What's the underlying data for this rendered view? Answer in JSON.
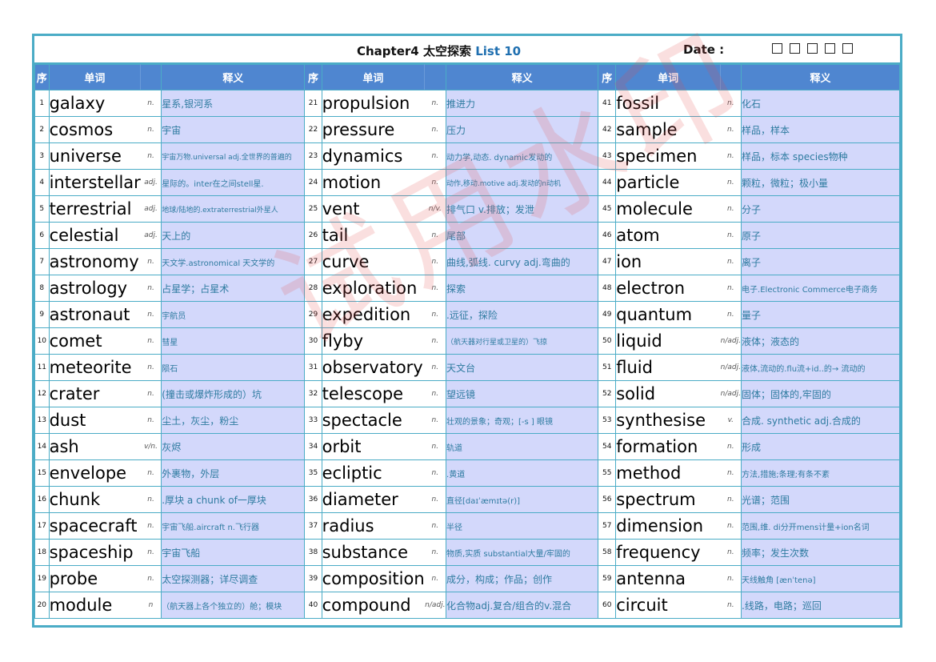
{
  "title": {
    "chapter": "Chapter4 太空探索",
    "list": "List 10"
  },
  "date": {
    "label": "Date :",
    "boxes": 5
  },
  "headers": {
    "seq": "序",
    "word": "单词",
    "meaning": "释义"
  },
  "watermark": "试用水印",
  "columns": [
    [
      {
        "n": "1",
        "word": "galaxy",
        "pos": "n.",
        "meaning": "星系,银河系"
      },
      {
        "n": "2",
        "word": "cosmos",
        "pos": "n.",
        "meaning": "宇宙"
      },
      {
        "n": "3",
        "word": "universe",
        "pos": "n.",
        "meaning": "宇宙万物.universal adj.全世界的普遍的",
        "size": "tiny"
      },
      {
        "n": "4",
        "word": "interstellar",
        "pos": "adj.",
        "meaning": "星际的。inter在之间stell星.",
        "size": "small"
      },
      {
        "n": "5",
        "word": "terrestrial",
        "pos": "adj.",
        "meaning": "地球/陆地的.extraterrestrial外星人",
        "size": "tiny"
      },
      {
        "n": "6",
        "word": "celestial",
        "pos": "adj.",
        "meaning": "天上的"
      },
      {
        "n": "7",
        "word": "astronomy",
        "pos": "n.",
        "meaning": "天文学.astronomical 天文学的",
        "size": "small"
      },
      {
        "n": "8",
        "word": "astrology",
        "pos": "n.",
        "meaning": "占星学；占星术"
      },
      {
        "n": "9",
        "word": "astronaut",
        "pos": "n.",
        "meaning": "宇航员",
        "size": "small"
      },
      {
        "n": "10",
        "word": "comet",
        "pos": "n.",
        "meaning": "彗星",
        "size": "small"
      },
      {
        "n": "11",
        "word": "meteorite",
        "pos": "n.",
        "meaning": "陨石",
        "size": "small"
      },
      {
        "n": "12",
        "word": "crater",
        "pos": "n.",
        "meaning": "(撞击或爆炸形成的）坑"
      },
      {
        "n": "13",
        "word": "dust",
        "pos": "n.",
        "meaning": "尘土，灰尘，粉尘"
      },
      {
        "n": "14",
        "word": "ash",
        "pos": "v/n.",
        "meaning": "灰烬"
      },
      {
        "n": "15",
        "word": "envelope",
        "pos": "n.",
        "meaning": "外裹物，外层"
      },
      {
        "n": "16",
        "word": "chunk",
        "pos": "n.",
        "meaning": ".厚块 a chunk of一厚块"
      },
      {
        "n": "17",
        "word": "spacecraft",
        "pos": "n.",
        "meaning": "宇宙飞船.aircraft n.飞行器",
        "size": "small"
      },
      {
        "n": "18",
        "word": "spaceship",
        "pos": "n.",
        "meaning": "宇宙飞船"
      },
      {
        "n": "19",
        "word": "probe",
        "pos": "n.",
        "meaning": "太空探测器；详尽调查"
      },
      {
        "n": "20",
        "word": "module",
        "pos": "n",
        "meaning": "（航天器上各个独立的）舱；模块",
        "size": "small"
      }
    ],
    [
      {
        "n": "21",
        "word": "propulsion",
        "pos": "n.",
        "meaning": "推进力"
      },
      {
        "n": "22",
        "word": "pressure",
        "pos": "n.",
        "meaning": "压力"
      },
      {
        "n": "23",
        "word": "dynamics",
        "pos": "n.",
        "meaning": "动力学,动态. dynamic发动的",
        "size": "small"
      },
      {
        "n": "24",
        "word": "motion",
        "pos": "n.",
        "meaning": "动作,移动.motive adj.发动的n动机",
        "size": "tiny"
      },
      {
        "n": "25",
        "word": "vent",
        "pos": "n/v.",
        "meaning": "排气口 v.排放；发泄"
      },
      {
        "n": "26",
        "word": "tail",
        "pos": "n.",
        "meaning": "尾部"
      },
      {
        "n": "27",
        "word": "curve",
        "pos": "n.",
        "meaning": "曲线,弧线. curvy adj.弯曲的"
      },
      {
        "n": "28",
        "word": "exploration",
        "pos": "n.",
        "meaning": "探索"
      },
      {
        "n": "29",
        "word": "expedition",
        "pos": "n.",
        "meaning": ".远征，探险"
      },
      {
        "n": "30",
        "word": "flyby",
        "pos": "n.",
        "meaning": "（航天器对行星或卫星的）飞掠",
        "size": "tiny"
      },
      {
        "n": "31",
        "word": "observatory",
        "pos": "n.",
        "meaning": "天文台"
      },
      {
        "n": "32",
        "word": "telescope",
        "pos": "n.",
        "meaning": "望远镜"
      },
      {
        "n": "33",
        "word": "spectacle",
        "pos": "n.",
        "meaning": "壮观的景象；奇观；[-s ] 眼镜",
        "size": "small"
      },
      {
        "n": "34",
        "word": "orbit",
        "pos": "n.",
        "meaning": "轨道",
        "size": "small"
      },
      {
        "n": "35",
        "word": "ecliptic",
        "pos": "n.",
        "meaning": ".黄道",
        "size": "small"
      },
      {
        "n": "36",
        "word": "diameter",
        "pos": "n.",
        "meaning": "直径[daɪˈæmɪtə(r)]",
        "size": "small"
      },
      {
        "n": "37",
        "word": "radius",
        "pos": "n.",
        "meaning": "半径",
        "size": "small"
      },
      {
        "n": "38",
        "word": "substance",
        "pos": "n.",
        "meaning": "物质,实质 substantial大量/牢固的",
        "size": "small"
      },
      {
        "n": "39",
        "word": "composition",
        "pos": "n.",
        "meaning": "成分，构成；作品；创作"
      },
      {
        "n": "40",
        "word": "compound",
        "pos": "n/adj.",
        "meaning": "化合物adj.复合/组合的v.混合"
      }
    ],
    [
      {
        "n": "41",
        "word": "fossil",
        "pos": "n.",
        "meaning": "化石"
      },
      {
        "n": "42",
        "word": "sample",
        "pos": "n.",
        "meaning": "样品，样本"
      },
      {
        "n": "43",
        "word": "specimen",
        "pos": "n.",
        "meaning": "样品，标本 species物种"
      },
      {
        "n": "44",
        "word": "particle",
        "pos": "n.",
        "meaning": "颗粒，微粒；极小量"
      },
      {
        "n": "45",
        "word": "molecule",
        "pos": "n.",
        "meaning": "分子"
      },
      {
        "n": "46",
        "word": "atom",
        "pos": "n.",
        "meaning": "原子"
      },
      {
        "n": "47",
        "word": "ion",
        "pos": "n.",
        "meaning": "离子"
      },
      {
        "n": "48",
        "word": "electron",
        "pos": "n.",
        "meaning": "电子.Electronic Commerce电子商务",
        "size": "small"
      },
      {
        "n": "49",
        "word": "quantum",
        "pos": "n.",
        "meaning": "量子"
      },
      {
        "n": "50",
        "word": "liquid",
        "pos": "n/adj.",
        "meaning": "液体；液态的"
      },
      {
        "n": "51",
        "word": "fluid",
        "pos": "n/adj.",
        "meaning": "液体,流动的.flu流+id..的→ 流动的",
        "size": "small"
      },
      {
        "n": "52",
        "word": "solid",
        "pos": "n/adj.",
        "meaning": "固体；固体的,牢固的"
      },
      {
        "n": "53",
        "word": "synthesise",
        "pos": "v.",
        "meaning": "合成. synthetic adj.合成的"
      },
      {
        "n": "54",
        "word": "formation",
        "pos": "n.",
        "meaning": "形成"
      },
      {
        "n": "55",
        "word": "method",
        "pos": "n.",
        "meaning": "方法,措施;条理;有条不紊",
        "size": "small"
      },
      {
        "n": "56",
        "word": "spectrum",
        "pos": "n.",
        "meaning": "光谱；范围"
      },
      {
        "n": "57",
        "word": "dimension",
        "pos": "n.",
        "meaning": "范围,维. di分开mens计量+ion名词",
        "size": "small"
      },
      {
        "n": "58",
        "word": "frequency",
        "pos": "n.",
        "meaning": "频率；发生次数"
      },
      {
        "n": "59",
        "word": "antenna",
        "pos": "n.",
        "meaning": "天线触角 [ænˈtenə]",
        "size": "small"
      },
      {
        "n": "60",
        "word": "circuit",
        "pos": "n.",
        "meaning": ".线路，电路；巡回"
      }
    ]
  ]
}
